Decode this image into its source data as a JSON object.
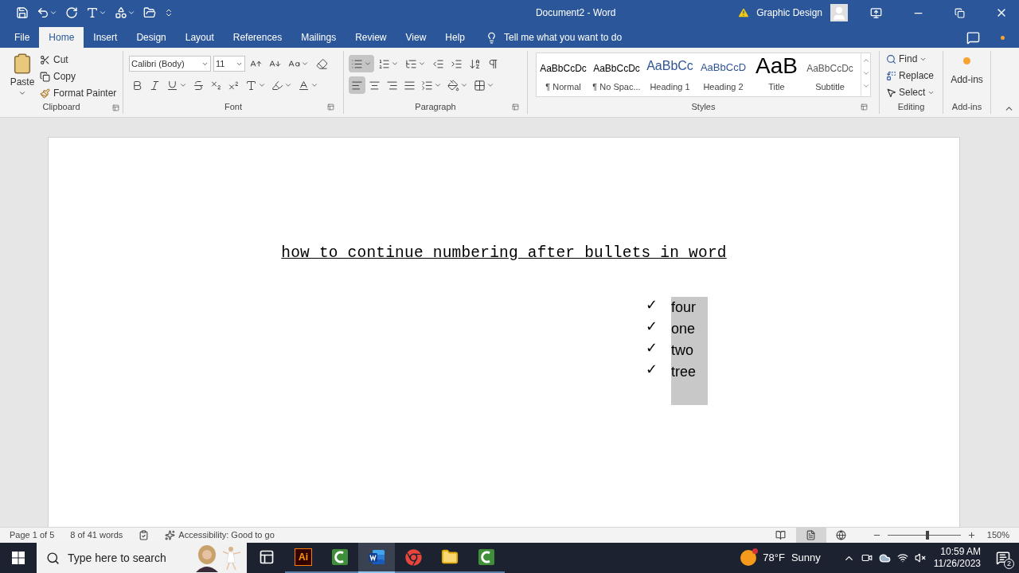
{
  "window": {
    "title": "Document2 - Word",
    "account": "Graphic Design"
  },
  "tabs": [
    {
      "label": "File",
      "selected": false
    },
    {
      "label": "Home",
      "selected": true
    },
    {
      "label": "Insert",
      "selected": false
    },
    {
      "label": "Design",
      "selected": false
    },
    {
      "label": "Layout",
      "selected": false
    },
    {
      "label": "References",
      "selected": false
    },
    {
      "label": "Mailings",
      "selected": false
    },
    {
      "label": "Review",
      "selected": false
    },
    {
      "label": "View",
      "selected": false
    },
    {
      "label": "Help",
      "selected": false
    }
  ],
  "tell_me": {
    "placeholder": "Tell me what you want to do"
  },
  "clipboard": {
    "label": "Clipboard",
    "paste": "Paste",
    "cut": "Cut",
    "copy": "Copy",
    "format_painter": "Format Painter"
  },
  "font": {
    "label": "Font",
    "font_name": "Calibri (Body)",
    "font_size": "11"
  },
  "paragraph": {
    "label": "Paragraph",
    "bullets_selected": true,
    "alignments": [
      {
        "kind": "left",
        "selected": true
      },
      {
        "kind": "center",
        "selected": false
      },
      {
        "kind": "right",
        "selected": false
      },
      {
        "kind": "justify",
        "selected": false
      }
    ]
  },
  "styles": {
    "label": "Styles",
    "items": [
      {
        "kind": "normal",
        "preview": "AaBbCcDc",
        "name": "¶ Normal"
      },
      {
        "kind": "normal",
        "preview": "AaBbCcDc",
        "name": "¶ No Spac..."
      },
      {
        "kind": "heading1",
        "preview": "AaBbCc",
        "name": "Heading 1"
      },
      {
        "kind": "heading2",
        "preview": "AaBbCcD",
        "name": "Heading 2"
      },
      {
        "kind": "title",
        "preview": "AaB",
        "name": "Title"
      },
      {
        "kind": "subtitle",
        "preview": "AaBbCcDc",
        "name": "Subtitle"
      }
    ]
  },
  "editing": {
    "label": "Editing",
    "find": "Find",
    "replace": "Replace",
    "select": "Select"
  },
  "add_ins": {
    "button": "Add-ins",
    "label": "Add-ins"
  },
  "document": {
    "title": "how to continue numbering after bullets in word",
    "bullet": "✓",
    "items": [
      {
        "text": "four",
        "selected": true
      },
      {
        "text": "one",
        "selected": true
      },
      {
        "text": "two",
        "selected": true
      },
      {
        "text": "tree",
        "selected": true
      }
    ]
  },
  "status_bar": {
    "page": "Page 1 of 5",
    "words": "8 of 41 words",
    "accessibility": "Accessibility: Good to go",
    "views": [
      {
        "kind": "read",
        "selected": false
      },
      {
        "kind": "print",
        "selected": true
      },
      {
        "kind": "web",
        "selected": false
      }
    ],
    "zoom": {
      "level": 0.55,
      "reading": "150%"
    }
  },
  "taskbar": {
    "search": {
      "placeholder": "Type here to search"
    },
    "apps": [
      {
        "kind": "task-view",
        "selected": false
      },
      {
        "kind": "illustrator",
        "label": "Ai",
        "selected": false
      },
      {
        "kind": "camtasia",
        "selected": false
      },
      {
        "kind": "word",
        "selected": true
      },
      {
        "kind": "chrome",
        "selected": false
      },
      {
        "kind": "explorer",
        "selected": false
      },
      {
        "kind": "camtasia",
        "selected": false
      }
    ],
    "weather": {
      "temperature": "78°F",
      "condition": "Sunny"
    },
    "clock": {
      "time": "10:59 AM",
      "date": "11/26/2023"
    },
    "notifications": "2"
  }
}
